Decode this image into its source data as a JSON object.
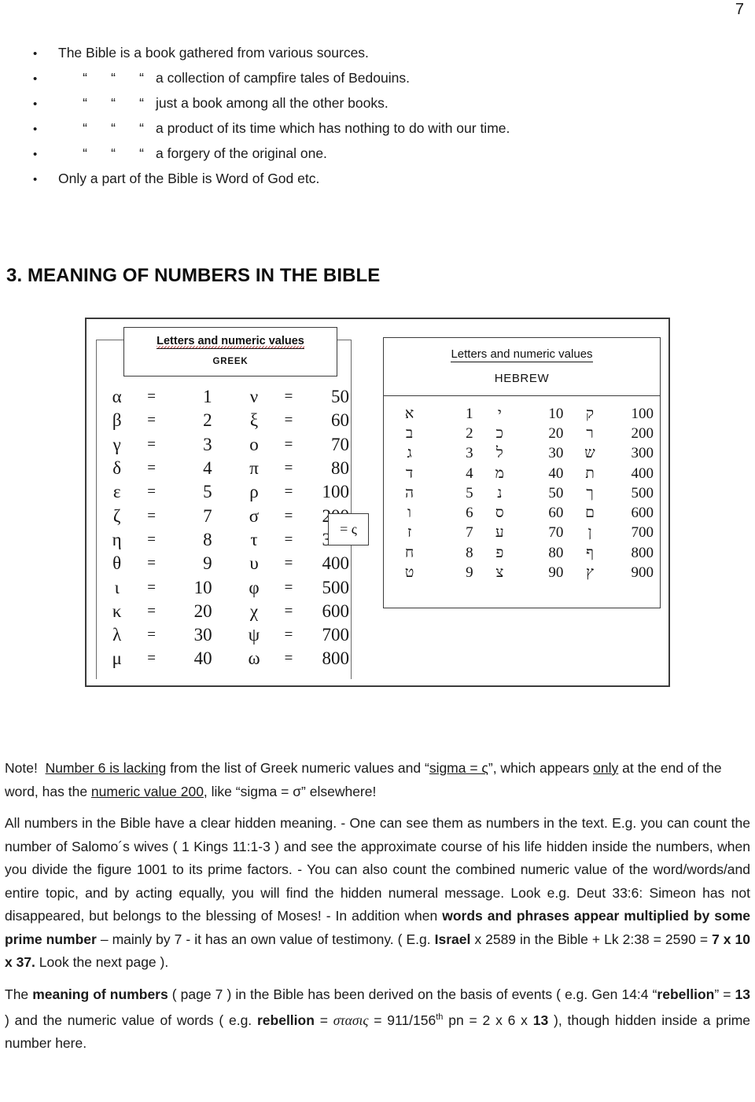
{
  "page": {
    "number": "7"
  },
  "bullets": [
    {
      "marker": "•",
      "ditto": [],
      "text": "The Bible is a book gathered from various sources."
    },
    {
      "marker": "•",
      "ditto": [
        "“",
        "“",
        "“"
      ],
      "text": "a collection of campfire tales of Bedouins."
    },
    {
      "marker": "•",
      "ditto": [
        "“",
        "“",
        "“"
      ],
      "text": "just a book among all the other books."
    },
    {
      "marker": "•",
      "ditto": [
        "“",
        "“",
        "“"
      ],
      "text": "a product of its time which has nothing to do with our time."
    },
    {
      "marker": "•",
      "ditto": [
        "“",
        "“",
        "“"
      ],
      "text": "a forgery of the original one."
    },
    {
      "marker": "•",
      "ditto": [],
      "text": "Only a part of the Bible is Word of God etc."
    }
  ],
  "heading": {
    "text": "3. MEANING OF NUMBERS IN THE BIBLE"
  },
  "figure": {
    "greek": {
      "title_main": "Letters and numeric values",
      "title_sub": "GREEK",
      "equals": "=",
      "rows": [
        {
          "l1": "α",
          "v1": "1",
          "l2": "ν",
          "v2": "50"
        },
        {
          "l1": "β",
          "v1": "2",
          "l2": "ξ",
          "v2": "60"
        },
        {
          "l1": "γ",
          "v1": "3",
          "l2": "ο",
          "v2": "70"
        },
        {
          "l1": "δ",
          "v1": "4",
          "l2": "π",
          "v2": "80"
        },
        {
          "l1": "ε",
          "v1": "5",
          "l2": "ρ",
          "v2": "100"
        },
        {
          "l1": "ζ",
          "v1": "7",
          "l2": "σ",
          "v2": "200"
        },
        {
          "l1": "η",
          "v1": "8",
          "l2": "τ",
          "v2": "300"
        },
        {
          "l1": "θ",
          "v1": "9",
          "l2": "υ",
          "v2": "400"
        },
        {
          "l1": "ι",
          "v1": "10",
          "l2": "φ",
          "v2": "500"
        },
        {
          "l1": "κ",
          "v1": "20",
          "l2": "χ",
          "v2": "600"
        },
        {
          "l1": "λ",
          "v1": "30",
          "l2": "ψ",
          "v2": "700"
        },
        {
          "l1": "μ",
          "v1": "40",
          "l2": "ω",
          "v2": "800"
        }
      ],
      "sigma_callout": "= ς"
    },
    "hebrew": {
      "title_main": "Letters and numeric values",
      "title_sub": "HEBREW",
      "rows": [
        {
          "l1": "א",
          "v1": "1",
          "l2": "י",
          "v2": "10",
          "l3": "ק",
          "v3": "100"
        },
        {
          "l1": "ב",
          "v1": "2",
          "l2": "כ",
          "v2": "20",
          "l3": "ר",
          "v3": "200"
        },
        {
          "l1": "ג",
          "v1": "3",
          "l2": "ל",
          "v2": "30",
          "l3": "ש",
          "v3": "300"
        },
        {
          "l1": "ד",
          "v1": "4",
          "l2": "מ",
          "v2": "40",
          "l3": "ת",
          "v3": "400"
        },
        {
          "l1": "ה",
          "v1": "5",
          "l2": "נ",
          "v2": "50",
          "l3": "ך",
          "v3": "500"
        },
        {
          "l1": "ו",
          "v1": "6",
          "l2": "ס",
          "v2": "60",
          "l3": "ם",
          "v3": "600"
        },
        {
          "l1": "ז",
          "v1": "7",
          "l2": "ע",
          "v2": "70",
          "l3": "ן",
          "v3": "700"
        },
        {
          "l1": "ח",
          "v1": "8",
          "l2": "פ",
          "v2": "80",
          "l3": "ף",
          "v3": "800"
        },
        {
          "l1": "ט",
          "v1": "9",
          "l2": "צ",
          "v2": "90",
          "l3": "ץ",
          "v3": "900"
        }
      ]
    }
  },
  "note": {
    "label": "Note!",
    "seg1": "Number 6 is lacking",
    "seg2": " from the list of Greek numeric values and “",
    "seg3": "sigma = ς",
    "seg4": "”, which appears ",
    "seg5": "only",
    "seg6": " at the end of the word, has the ",
    "seg7": "numeric value 200,",
    "seg8": " like “sigma = σ” elsewhere!"
  },
  "paragraph2": {
    "t1": "All numbers in the Bible have a clear hidden meaning. - One can see them as numbers in the text. E.g. you can count the number of Salomo´s wives ( 1 Kings 11:1-3 ) and see the approximate course of his life hidden inside the numbers, when you divide the figure 1001 to its prime factors. - You can also count the combined numeric value of the word/words/and entire topic, and by acting equally, you will find the hidden numeral message. Look e.g. Deut 33:6: Simeon has not disappeared, but belongs to the blessing of Moses!  - In addition when ",
    "b1": "words and phrases appear multiplied by some prime number",
    "t2": " – mainly by 7 - it has an own value of testimony. ( E.g. ",
    "b2": "Israel",
    "t3": " x 2589 in the Bible + Lk 2:38 = 2590 = ",
    "b3": "7 x 10 x 37.",
    "t4": "  Look the next page )."
  },
  "paragraph3": {
    "t1": "The ",
    "b1": "meaning of numbers",
    "t2": " ( page 7 ) in the Bible has been derived on the basis of events ( e.g. Gen 14:4 “",
    "b2": "rebellion",
    "t3": "” = ",
    "b3": "13",
    "t4": " ) and the numeric value of words ( e.g. ",
    "b4": "rebellion",
    "t5": " = ",
    "gk1": "στασις",
    "t6": " = 911/156",
    "sup1": "th",
    "t7": " pn = 2 x 6 x ",
    "b5": "13",
    "t8": " ), though hidden inside a prime number here."
  }
}
